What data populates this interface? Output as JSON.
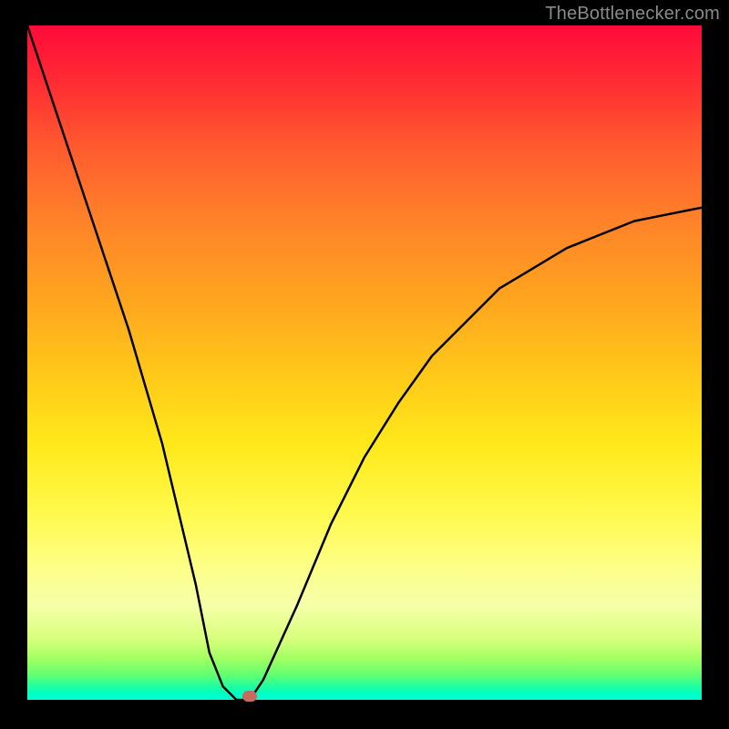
{
  "watermark": "TheBottlenecker.com",
  "chart_data": {
    "type": "line",
    "title": "",
    "xlabel": "",
    "ylabel": "",
    "xlim": [
      0,
      1
    ],
    "ylim": [
      0,
      1
    ],
    "x": [
      0.0,
      0.05,
      0.1,
      0.15,
      0.2,
      0.25,
      0.27,
      0.29,
      0.31,
      0.33,
      0.35,
      0.4,
      0.45,
      0.5,
      0.55,
      0.6,
      0.65,
      0.7,
      0.75,
      0.8,
      0.85,
      0.9,
      0.95,
      1.0
    ],
    "values": [
      1.0,
      0.85,
      0.7,
      0.55,
      0.38,
      0.17,
      0.07,
      0.02,
      0.0,
      0.0,
      0.03,
      0.14,
      0.26,
      0.36,
      0.44,
      0.51,
      0.56,
      0.61,
      0.64,
      0.67,
      0.69,
      0.71,
      0.72,
      0.73
    ],
    "marker": {
      "x": 0.33,
      "y": 0.0
    },
    "background_gradient": {
      "top": "#ff0a3a",
      "mid_upper": "#ffa31f",
      "mid": "#ffe81a",
      "mid_lower": "#d7ff7c",
      "bottom": "#00ffc0"
    },
    "frame_color": "#000000",
    "curve_color": "#000000",
    "marker_color": "#c96a5f"
  }
}
